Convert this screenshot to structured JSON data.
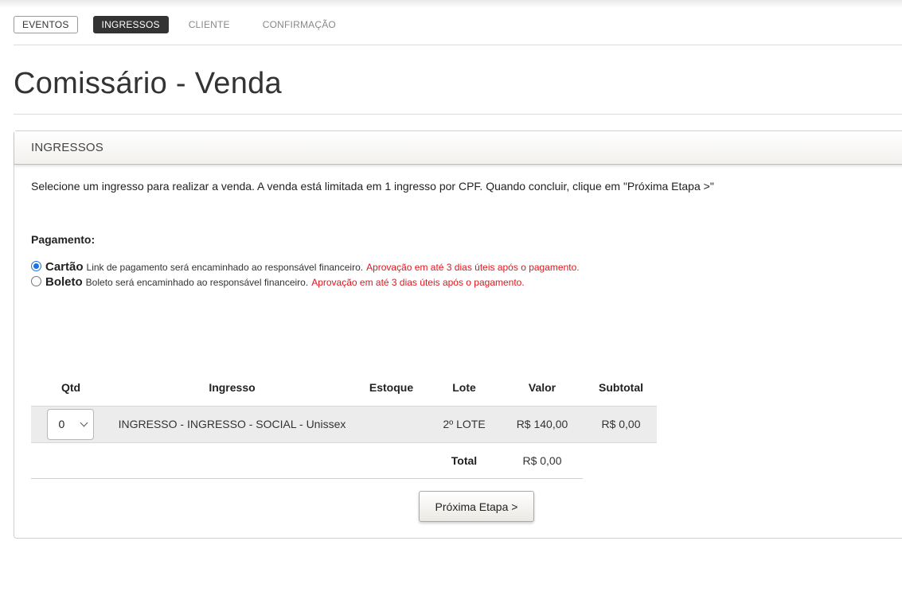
{
  "steps": [
    {
      "label": "EVENTOS"
    },
    {
      "label": "INGRESSOS"
    },
    {
      "label": "CLIENTE"
    },
    {
      "label": "CONFIRMAÇÃO"
    }
  ],
  "page_title": "Comissário - Venda",
  "panel": {
    "title": "INGRESSOS",
    "instructions": "Selecione um ingresso para realizar a venda. A venda está limitada em 1 ingresso por CPF. Quando concluir, clique em \"Próxima Etapa >\""
  },
  "payment": {
    "label": "Pagamento:",
    "options": [
      {
        "name": "Cartão",
        "description": "Link de pagamento será encaminhado ao responsável financeiro.",
        "warning": "Aprovação em até 3 dias úteis após o pagamento.",
        "checked": true
      },
      {
        "name": "Boleto",
        "description": "Boleto será encaminhado ao responsável financeiro.",
        "warning": "Aprovação em até 3 dias úteis após o pagamento.",
        "checked": false
      }
    ]
  },
  "table": {
    "headers": {
      "qtd": "Qtd",
      "ingresso": "Ingresso",
      "estoque": "Estoque",
      "lote": "Lote",
      "valor": "Valor",
      "subtotal": "Subtotal"
    },
    "rows": [
      {
        "qtd": "0",
        "ingresso": "INGRESSO - INGRESSO - SOCIAL - Unissex",
        "estoque": "",
        "lote": "2º LOTE",
        "valor": "R$ 140,00",
        "subtotal": "R$ 0,00"
      }
    ],
    "total_label": "Total",
    "total_value": "R$ 0,00"
  },
  "next_button": "Próxima Etapa >",
  "colors": {
    "accent_dark": "#333333",
    "warning_red": "#e0161c",
    "radio_blue": "#1a73e8"
  }
}
